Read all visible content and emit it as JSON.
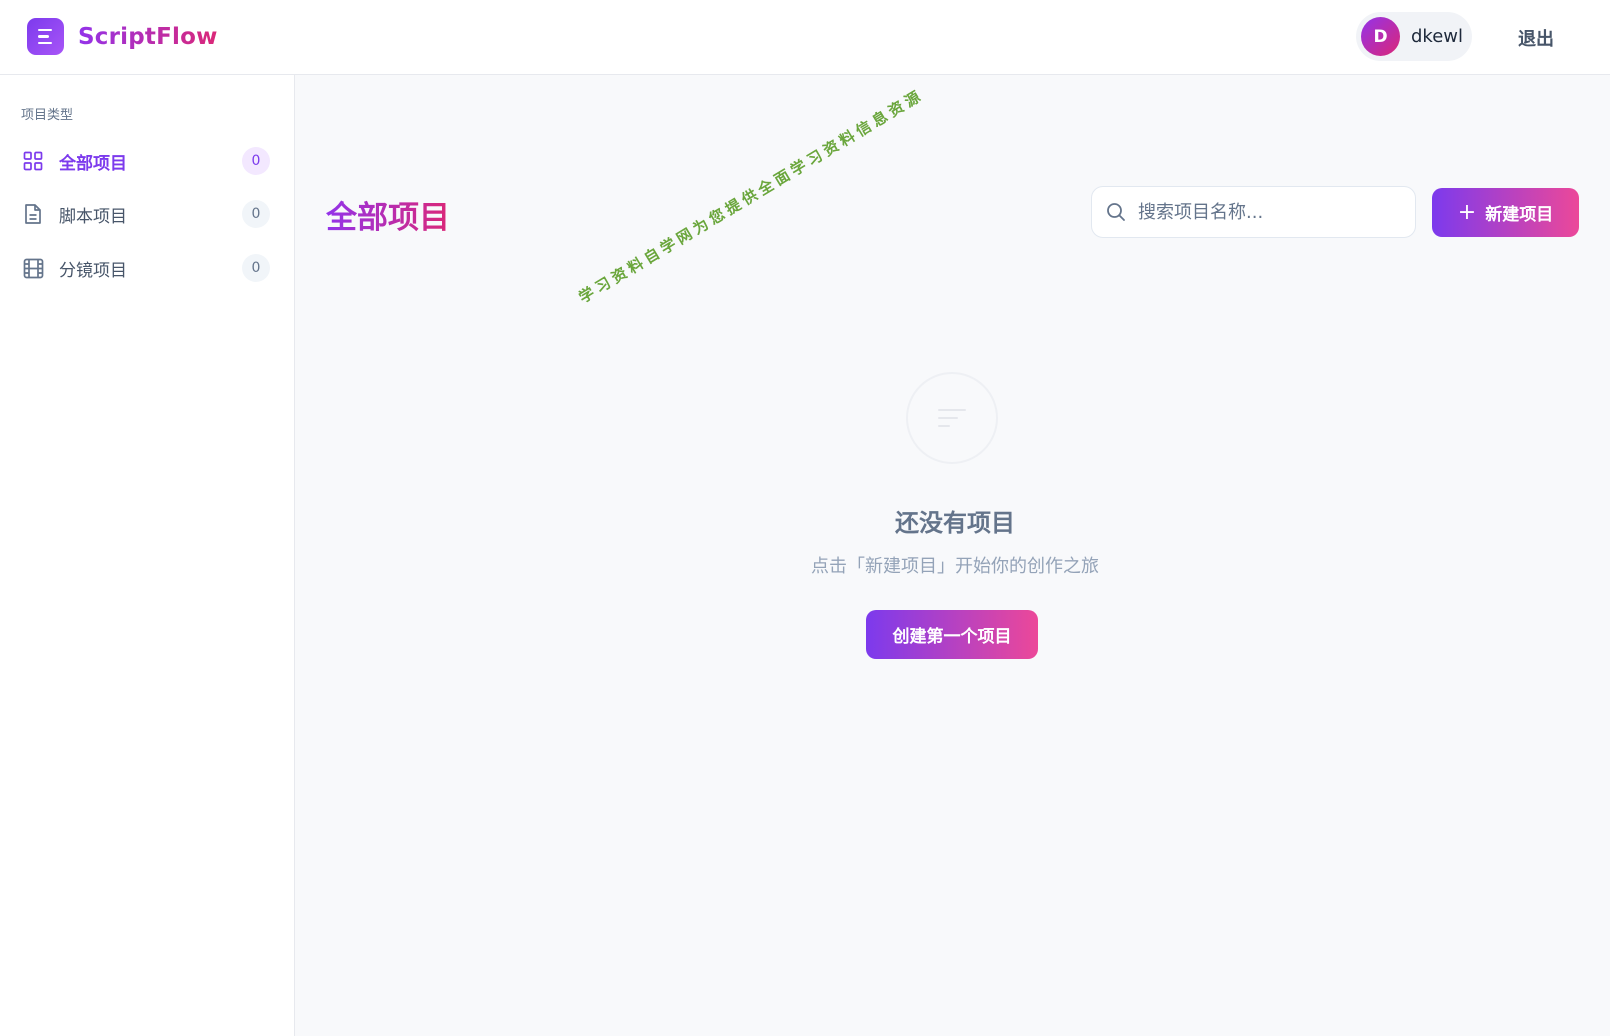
{
  "header": {
    "app_name": "ScriptFlow",
    "logo_icon": "menu-lines-icon",
    "user": {
      "avatar_letter": "D",
      "name": "dkewl"
    },
    "logout_label": "退出"
  },
  "sidebar": {
    "section_title": "项目类型",
    "items": [
      {
        "label": "全部项目",
        "count": "0",
        "icon": "grid-icon",
        "active": true
      },
      {
        "label": "脚本项目",
        "count": "0",
        "icon": "document-icon",
        "active": false
      },
      {
        "label": "分镜项目",
        "count": "0",
        "icon": "film-icon",
        "active": false
      }
    ]
  },
  "main": {
    "title": "全部项目",
    "search": {
      "placeholder": "搜索项目名称...",
      "value": ""
    },
    "new_button_label": "新建项目",
    "watermark": "学习资料自学网为您提供全面学习资料信息资源",
    "empty": {
      "title": "还没有项目",
      "subtitle": "点击「新建项目」开始你的创作之旅",
      "button_label": "创建第一个项目"
    }
  },
  "colors": {
    "accent_purple": "#7c3aed",
    "accent_pink": "#ec4899",
    "watermark_green": "#6aa63c"
  }
}
